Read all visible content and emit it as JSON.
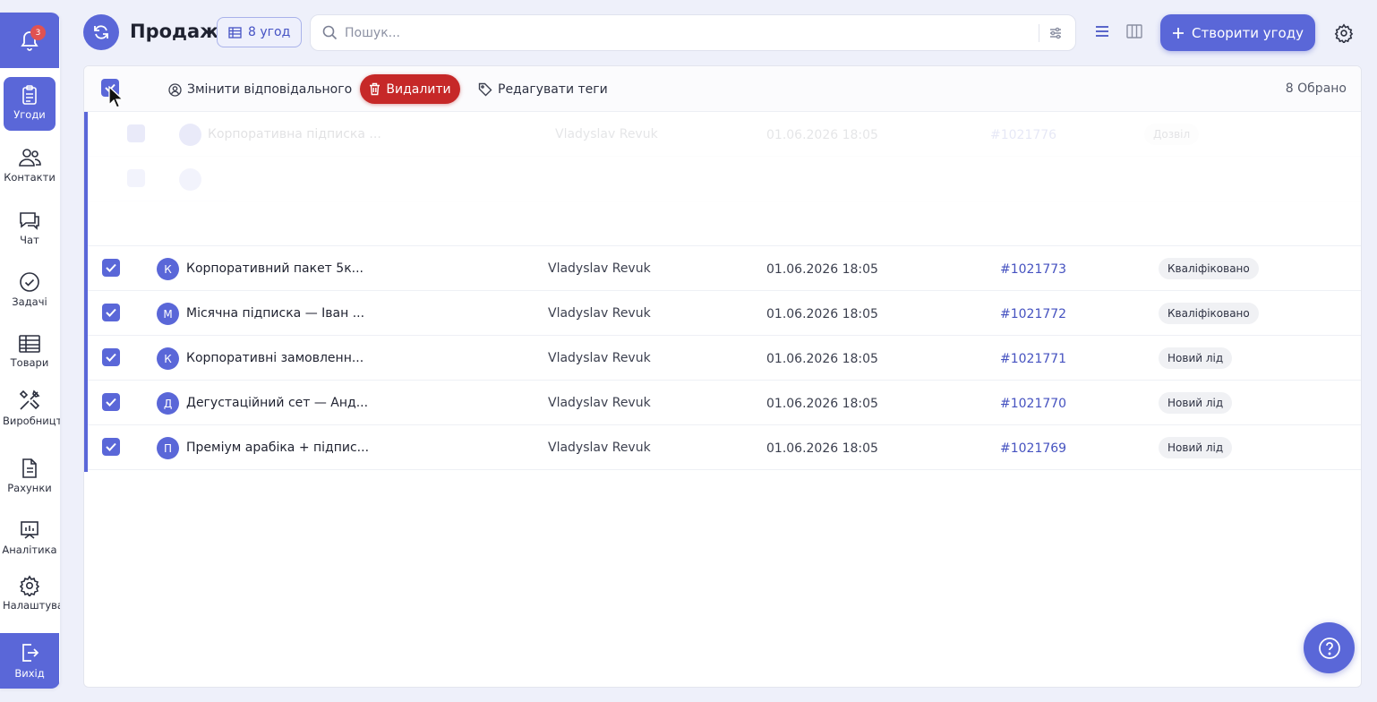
{
  "notifications": {
    "count": "3"
  },
  "sidebar": {
    "items": [
      {
        "label": "Угоди",
        "icon": "clipboard-icon"
      },
      {
        "label": "Контакти",
        "icon": "users-icon"
      },
      {
        "label": "Чат",
        "icon": "chat-icon"
      },
      {
        "label": "Задачі",
        "icon": "check-circle-icon"
      },
      {
        "label": "Товари",
        "icon": "table-icon"
      },
      {
        "label": "Виробництво",
        "icon": "tools-icon"
      },
      {
        "label": "Рахунки",
        "icon": "document-icon"
      },
      {
        "label": "Аналітика",
        "icon": "chart-icon"
      },
      {
        "label": "Налаштування",
        "icon": "gear-icon"
      }
    ],
    "logout_label": "Вихід"
  },
  "header": {
    "title": "Продажі",
    "deal_count": "8 угод",
    "search_placeholder": "Пошук...",
    "create_label": "Створити угоду"
  },
  "bulk": {
    "change_owner": "Змінити відповідального",
    "delete": "Видалити",
    "edit_tags": "Редагувати теги",
    "selected": "8 Обрано"
  },
  "ghost_rows": [
    {
      "name": "Корпоративна підписка ...",
      "owner": "Vladyslav Revuk",
      "date": "01.06.2026 18:05",
      "id": "#1021776",
      "status": "Дозвіл"
    }
  ],
  "rows": [
    {
      "initial": "К",
      "name": "Корпоративний пакет 5к...",
      "owner": "Vladyslav Revuk",
      "date": "01.06.2026 18:05",
      "id": "#1021773",
      "status": "Кваліфіковано"
    },
    {
      "initial": "М",
      "name": "Місячна підписка — Іван ...",
      "owner": "Vladyslav Revuk",
      "date": "01.06.2026 18:05",
      "id": "#1021772",
      "status": "Кваліфіковано"
    },
    {
      "initial": "К",
      "name": "Корпоративні замовленн...",
      "owner": "Vladyslav Revuk",
      "date": "01.06.2026 18:05",
      "id": "#1021771",
      "status": "Новий лід"
    },
    {
      "initial": "Д",
      "name": "Дегустаційний сет — Анд...",
      "owner": "Vladyslav Revuk",
      "date": "01.06.2026 18:05",
      "id": "#1021770",
      "status": "Новий лід"
    },
    {
      "initial": "П",
      "name": "Преміум арабіка + підпис...",
      "owner": "Vladyslav Revuk",
      "date": "01.06.2026 18:05",
      "id": "#1021769",
      "status": "Новий лід"
    }
  ],
  "colors": {
    "accent": "#5a67d8",
    "danger": "#c62828",
    "link": "#4552c0"
  }
}
